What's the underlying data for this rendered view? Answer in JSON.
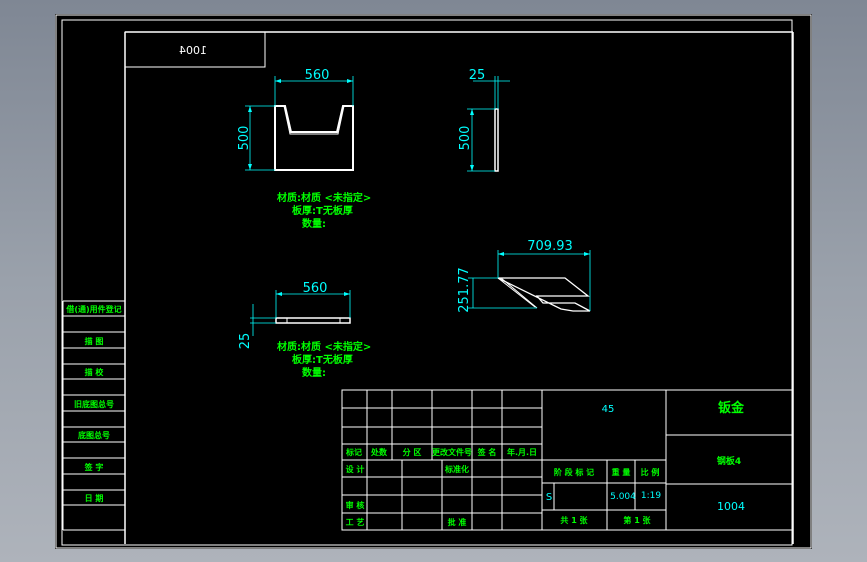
{
  "sheet_code_mirrored": "1004",
  "views": {
    "front": {
      "width": "560",
      "height": "500"
    },
    "side": {
      "thickness": "25",
      "height": "500"
    },
    "top": {
      "width": "560",
      "thickness": "25"
    },
    "iso": {
      "length": "709.93",
      "height": "251.77"
    }
  },
  "notes": {
    "material": "材质:材质 <未指定>",
    "thickness": "板厚:T无板厚",
    "quantity": "数量:"
  },
  "left_strip": [
    "借(通)用件登记",
    "描 图",
    "描 校",
    "旧底图总号",
    "底图总号",
    "签 字",
    "日 期"
  ],
  "title_block": {
    "header_cells": [
      "标记",
      "处数",
      "分 区",
      "更改文件号",
      "签 名",
      "年.月.日"
    ],
    "design": "设 计",
    "standardize": "标准化",
    "review": "审 核",
    "process": "工 艺",
    "approve": "批 准",
    "material_value": "45",
    "stage_label": "阶 段 标 记",
    "weight_label": "重 量",
    "scale_label": "比 例",
    "stage_value": "S",
    "weight_value": "5.004",
    "scale_value": "1:19",
    "sheets_total": "共 1 张",
    "sheet_no": "第 1 张",
    "part_name": "钣金",
    "part_type": "钢板4",
    "drawing_no": "1004"
  }
}
